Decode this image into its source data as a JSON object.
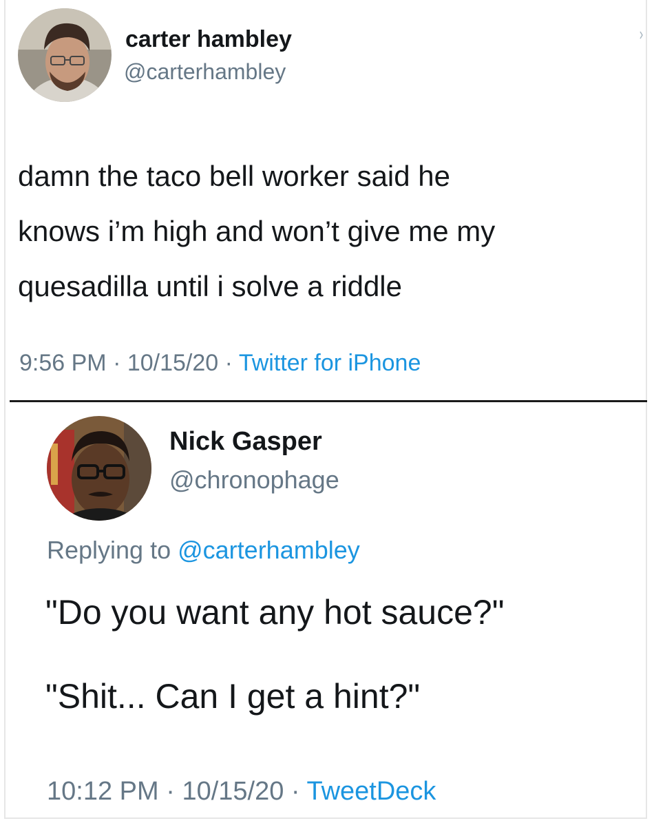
{
  "tweet1": {
    "display_name": "carter hambley",
    "handle": "@carterhambley",
    "text_lines": [
      "damn the taco bell worker said he",
      "knows i’m high and won’t give me my",
      "quesadilla until i solve a riddle"
    ],
    "time": "9:56 PM",
    "date": "10/15/20",
    "source": "Twitter for iPhone",
    "separator": " · ",
    "menu_icon": "chevron-down-icon"
  },
  "tweet2": {
    "display_name": "Nick Gasper",
    "handle": "@chronophage",
    "replying_prefix": "Replying to ",
    "replying_to": "@carterhambley",
    "text_lines": [
      "\"Do you want any hot sauce?\"",
      "\"Shit... Can I get a hint?\""
    ],
    "time": "10:12 PM",
    "date": "10/15/20",
    "source": "TweetDeck",
    "separator": " · "
  },
  "colors": {
    "primary_text": "#14171a",
    "secondary_text": "#657786",
    "link": "#1b95e0",
    "divider": "#1a1a1a"
  }
}
